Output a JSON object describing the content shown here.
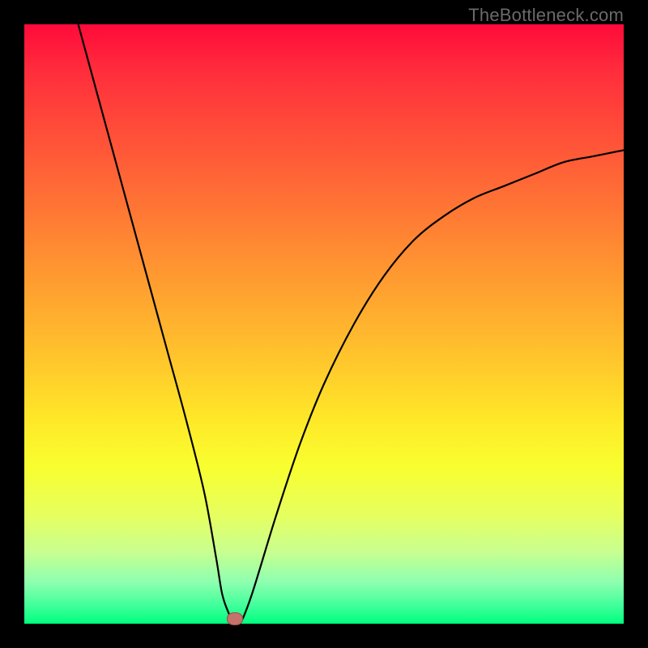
{
  "watermark": "TheBottleneck.com",
  "colors": {
    "frame": "#000000",
    "watermark_text": "#6a6a6a",
    "curve": "#000000",
    "marker_fill": "#c7716c",
    "marker_border": "#9a4f49",
    "gradient_stops": [
      "#ff0a3a",
      "#ff2e3c",
      "#ff5438",
      "#ff7a34",
      "#ffa030",
      "#ffc62c",
      "#ffe828",
      "#f8ff30",
      "#e6ff60",
      "#c8ff90",
      "#8fffb0",
      "#40ff9a",
      "#00ff80"
    ]
  },
  "chart_data": {
    "type": "line",
    "title": "",
    "xlabel": "",
    "ylabel": "",
    "xlim": [
      0,
      100
    ],
    "ylim": [
      0,
      100
    ],
    "series": [
      {
        "name": "curve",
        "x": [
          9,
          12,
          15,
          18,
          21,
          24,
          27,
          30,
          32,
          33,
          34,
          35,
          36,
          38,
          42,
          46,
          50,
          55,
          60,
          65,
          70,
          75,
          80,
          85,
          90,
          95,
          100
        ],
        "y": [
          100,
          89,
          78,
          67,
          56,
          45,
          34,
          22,
          11,
          5,
          2,
          0,
          0,
          5,
          18,
          30,
          40,
          50,
          58,
          64,
          68,
          71,
          73,
          75,
          77,
          78,
          79
        ]
      }
    ],
    "marker": {
      "x": 35,
      "y": 1
    },
    "note": "x and y are in percent of plot area; axes and ticks are not rendered in the image"
  }
}
